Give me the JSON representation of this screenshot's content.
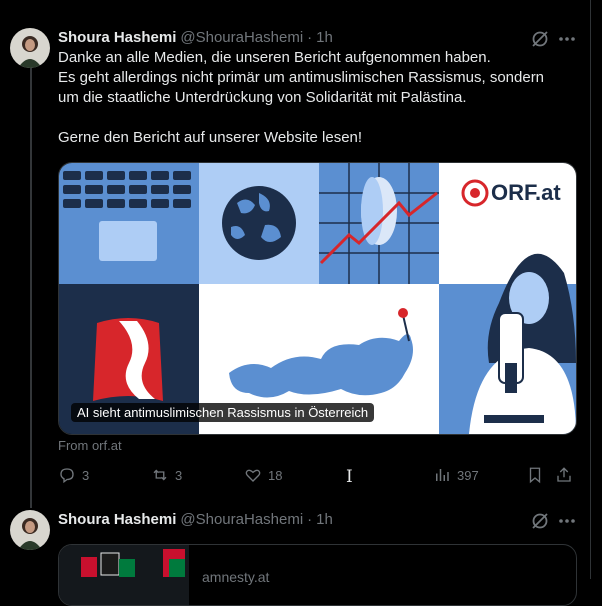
{
  "tweet1": {
    "name": "Shoura Hashemi",
    "handle": "@ShouraHashemi",
    "dot": "·",
    "time": "1h",
    "lines": [
      "Danke an alle Medien, die unseren Bericht aufgenommen haben.",
      "Es geht allerdings nicht primär um antimuslimischen Rassismus, sondern",
      "um die staatliche Unterdrückung von Solidarität mit Palästina."
    ],
    "line_last": "Gerne den Bericht auf unserer Website lesen!",
    "card": {
      "logo": "ORF.at",
      "caption": "AI sieht antimuslimischen Rassismus in Österreich"
    },
    "from": "From orf.at",
    "actions": {
      "replies": "3",
      "reposts": "3",
      "likes": "18",
      "views": "397"
    }
  },
  "tweet2": {
    "name": "Shoura Hashemi",
    "handle": "@ShouraHashemi",
    "dot": "·",
    "time": "1h",
    "card_domain": "amnesty.at"
  },
  "icons": {
    "grok": "grok-icon",
    "more": "more-icon",
    "reply": "reply-icon",
    "repost": "repost-icon",
    "like": "heart-icon",
    "views": "views-icon",
    "bookmark": "bookmark-icon",
    "share": "share-icon"
  },
  "colors": {
    "background": "#000000",
    "text": "#e7e9ea",
    "muted": "#71767b",
    "orf_red": "#d7262b"
  }
}
